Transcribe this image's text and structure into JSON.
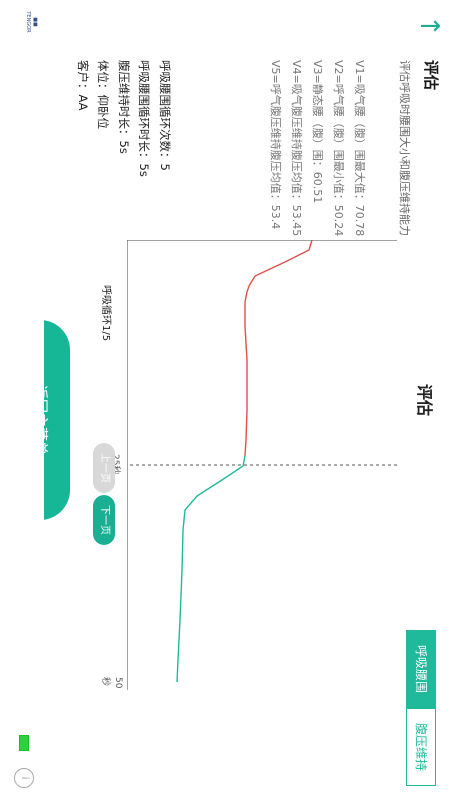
{
  "status_bar": {
    "logo_text": "TENGOR",
    "circle_text": "i"
  },
  "header": {
    "section_title": "评估",
    "description": "评估呼吸时腰围大小和腹压维持能力",
    "values": [
      "V1=吸气腰（腹）围最大值：70.78",
      "V2=呼气腰（腹）围最小值：50.24",
      "V3=静态腰（腹）围：60.51",
      "V4=吸气腹压维持腹压均值：53.45",
      "V5=呼气腹压维持腹压均值：53.4"
    ]
  },
  "page_title": "评估",
  "params": [
    "呼吸腰围循环次数：5",
    "呼吸腰围循环时长：5s",
    "腹压维持时长：5s",
    "体位：仰卧位",
    "客户：AA"
  ],
  "tabs": {
    "active": "呼吸腰围",
    "inactive": "腹压维持"
  },
  "chart_data": {
    "type": "line",
    "x_ticks": [
      "25秒",
      "50秒"
    ],
    "series": [
      {
        "color": "#e0504a"
      },
      {
        "color": "#20b99c"
      }
    ],
    "cycle_label": "呼吸循环1/5"
  },
  "buttons": {
    "prev": "上一页",
    "next": "下一页",
    "main_menu": "返回主菜单"
  },
  "colors": {
    "accent": "#16b797",
    "red": "#e0504a"
  }
}
